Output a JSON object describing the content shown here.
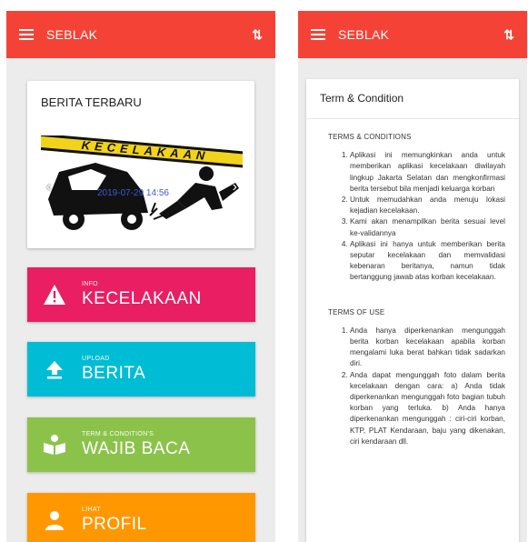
{
  "colors": {
    "primary": "#f44336",
    "info_tile": "#e91e63",
    "upload_tile": "#00bcd4",
    "terms_tile": "#8bc34a",
    "profile_tile": "#ff9800"
  },
  "left_screen": {
    "appbar": {
      "title": "SEBLAK",
      "menu_icon": "hamburger-icon",
      "action_icon": "sort-icon"
    },
    "news": {
      "title": "BERITA TERBARU",
      "image_tape_text": "KECELAKAAN",
      "date_caption": "2019-07-29 14:56",
      "prev_icon": "chevron-left-icon",
      "next_icon": "chevron-right-icon"
    },
    "tiles": [
      {
        "id": "info",
        "small": "INFO",
        "big": "KECELAKAAN",
        "icon": "warning-icon"
      },
      {
        "id": "upload",
        "small": "UPLOAD",
        "big": "BERITA",
        "icon": "upload-icon"
      },
      {
        "id": "terms",
        "small": "TERM & CONDITION'S",
        "big": "WAJIB BACA",
        "icon": "book-reader-icon"
      },
      {
        "id": "profile",
        "small": "LIHAT",
        "big": "PROFIL",
        "icon": "person-icon"
      }
    ]
  },
  "right_screen": {
    "appbar": {
      "title": "SEBLAK",
      "menu_icon": "hamburger-icon",
      "action_icon": "sort-icon"
    },
    "card_title": "Term & Condition",
    "sections": [
      {
        "heading": "TERMS & CONDITIONS",
        "items": [
          "Aplikasi ini memungkinkan anda untuk memberikan aplikasi kecelakaan diwilayah lingkup Jakarta Selatan dan mengkonfirmasi berita tersebut bila menjadi keluarga korban",
          "Untuk memudahkan anda menuju lokasi kejadian kecelakaan.",
          "Kami akan menampilkan berita sesuai level ke-validannya",
          "Aplikasi ini hanya untuk memberikan berita seputar kecelakaan dan memvalidasi kebenaran beritanya, namun tidak bertanggung jawab atas korban kecelakaan."
        ]
      },
      {
        "heading": "TERMS OF USE",
        "items": [
          "Anda hanya diperkenankan mengunggah berita korban kecelakaan apabila korban mengalami luka berat bahkan tidak sadarkan diri.",
          "Anda dapat mengunggah foto dalam berita kecelakaan dengan cara: a) Anda tidak diperkenankan mengunggah foto bagian tubuh korban yang terluka. b) Anda hanya diperkenankan mengunggah : ciri-ciri korban, KTP, PLAT Kendaraan, baju yang dikenakan, ciri kendaraan dll."
        ]
      }
    ]
  }
}
